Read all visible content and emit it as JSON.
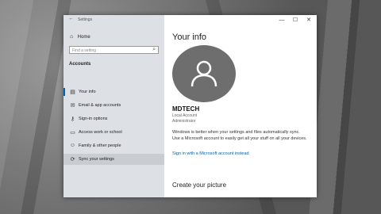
{
  "window": {
    "title": "Settings",
    "back_icon": "back-arrow-icon",
    "controls": {
      "minimize": "—",
      "maximize": "☐",
      "close": "✕"
    }
  },
  "sidebar": {
    "home_label": "Home",
    "search_placeholder": "Find a setting",
    "section_title": "Accounts",
    "items": [
      {
        "label": "Your info",
        "icon": "person-card-icon",
        "active": true
      },
      {
        "label": "Email & app accounts",
        "icon": "email-icon"
      },
      {
        "label": "Sign-in options",
        "icon": "key-icon"
      },
      {
        "label": "Access work or school",
        "icon": "briefcase-icon"
      },
      {
        "label": "Family & other people",
        "icon": "people-icon"
      },
      {
        "label": "Sync your settings",
        "icon": "sync-icon",
        "hover": true
      }
    ]
  },
  "main": {
    "title": "Your info",
    "user_name": "MDTECH",
    "account_type": "Local Account",
    "account_role": "Administrator",
    "info_text": "Windows is better when your settings and files automatically sync. Use a Microsoft account to easily get all your stuff on all your devices.",
    "ms_link": "Sign in with a Microsoft account instead",
    "create_picture": "Create your picture"
  },
  "colors": {
    "accent": "#0063b1",
    "sidebar_bg": "#dde0e4",
    "avatar_bg": "#6e6e6e"
  }
}
